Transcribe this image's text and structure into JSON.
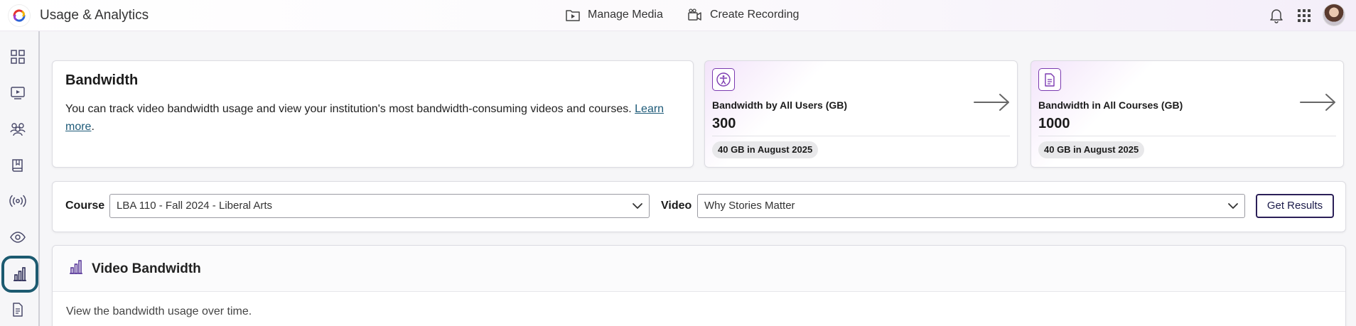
{
  "app": {
    "title": "Usage & Analytics"
  },
  "topnav": {
    "manage_media": "Manage Media",
    "create_recording": "Create Recording"
  },
  "bandwidth": {
    "title": "Bandwidth",
    "description": "You can track video bandwidth usage and view your institution's most bandwidth-consuming videos and courses.",
    "learn_more": "Learn more",
    "period": "."
  },
  "stats": [
    {
      "label": "Bandwidth by All Users (GB)",
      "value": "300",
      "badge": "40 GB in August 2025",
      "icon": "accessibility-icon"
    },
    {
      "label": "Bandwidth in All Courses (GB)",
      "value": "1000",
      "badge": "40 GB in August 2025",
      "icon": "document-icon"
    }
  ],
  "filters": {
    "course_label": "Course",
    "course_value": "LBA 110 - Fall 2024 - Liberal Arts",
    "video_label": "Video",
    "video_value": "Why Stories Matter",
    "submit": "Get Results"
  },
  "video_bandwidth": {
    "title": "Video Bandwidth",
    "description": "View the bandwidth usage over time."
  },
  "colors": {
    "accent": "#7b3ab0",
    "active_nav": "#1c5a70",
    "button_border": "#2b1f57",
    "link": "#1d5a78"
  }
}
